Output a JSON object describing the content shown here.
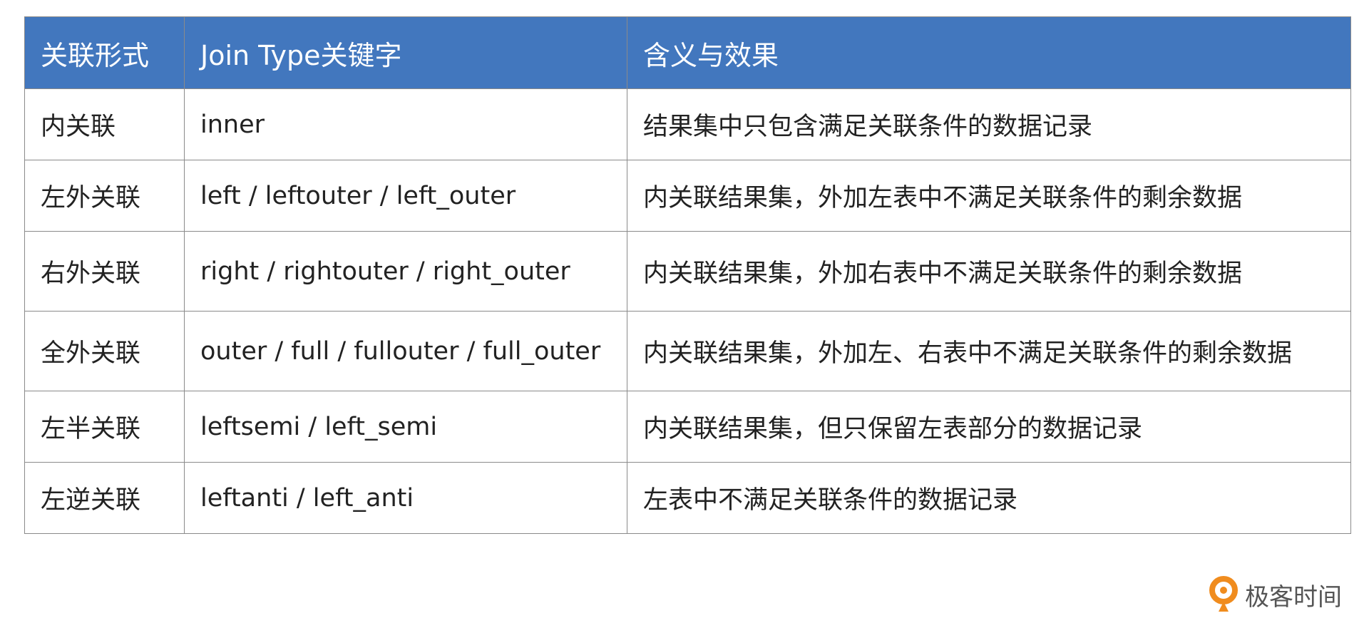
{
  "table": {
    "headers": [
      "关联形式",
      "Join Type关键字",
      "含义与效果"
    ],
    "rows": [
      [
        "内关联",
        "inner",
        "结果集中只包含满足关联条件的数据记录"
      ],
      [
        "左外关联",
        "left / leftouter / left_outer",
        "内关联结果集，外加左表中不满足关联条件的剩余数据"
      ],
      [
        "右外关联",
        "right / rightouter / right_outer",
        "内关联结果集，外加右表中不满足关联条件的剩余数据"
      ],
      [
        "全外关联",
        "outer / full / fullouter / full_outer",
        "内关联结果集，外加左、右表中不满足关联条件的剩余数据"
      ],
      [
        "左半关联",
        "leftsemi / left_semi",
        "内关联结果集，但只保留左表部分的数据记录"
      ],
      [
        "左逆关联",
        "leftanti / left_anti",
        "左表中不满足关联条件的数据记录"
      ]
    ]
  },
  "brand": {
    "name": "极客时间",
    "icon": "geektime-logo-icon"
  },
  "colors": {
    "header_bg": "#4277be",
    "header_text": "#ffffff",
    "border": "#8a8a8a",
    "logo_orange": "#f08c1e"
  }
}
